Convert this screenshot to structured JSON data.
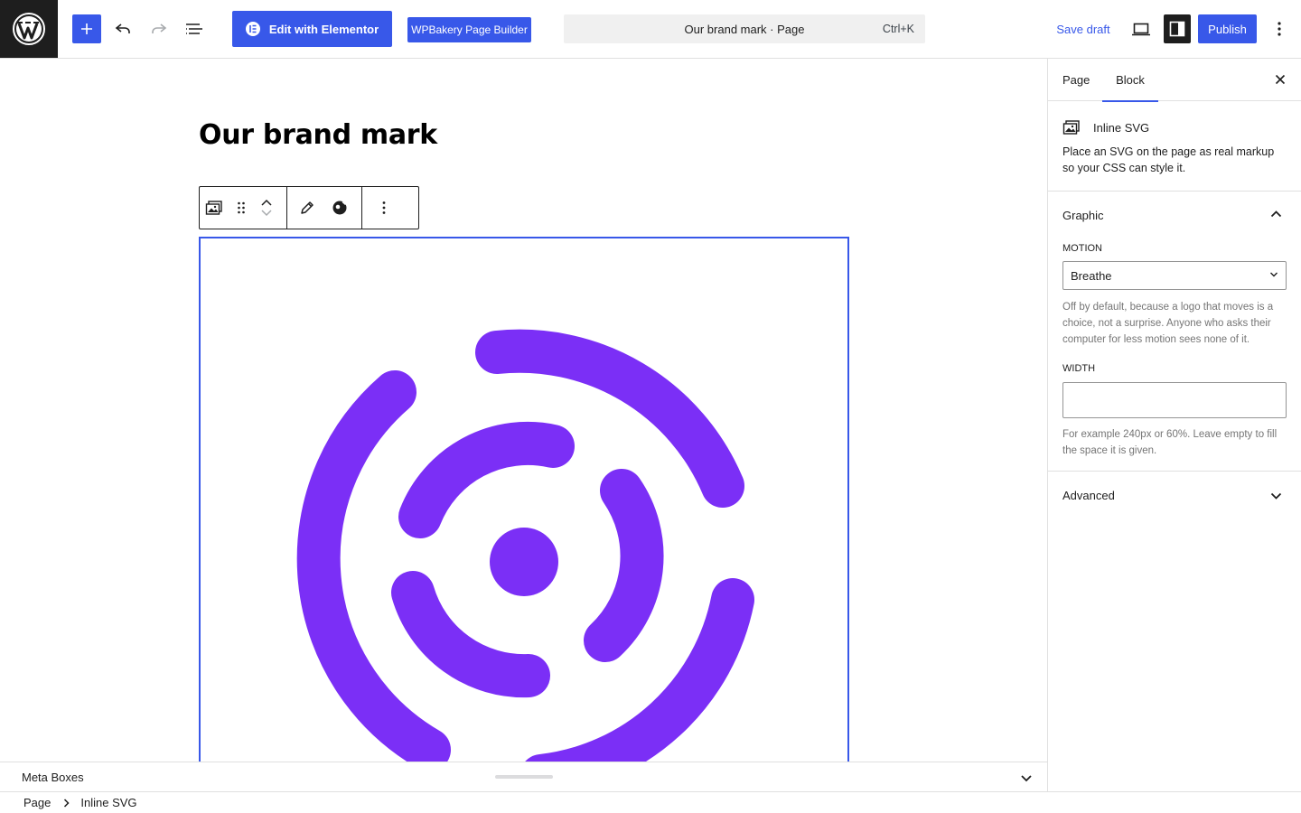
{
  "topbar": {
    "elementor_label": "Edit with Elementor",
    "wpbakery_label": "WPBakery Page Builder",
    "command_title": "Our brand mark · Page",
    "command_shortcut": "Ctrl+K",
    "save_draft_label": "Save draft",
    "publish_label": "Publish"
  },
  "editor": {
    "page_title": "Our brand mark"
  },
  "logo": {
    "color": "#7b2ff6"
  },
  "colors": {
    "accent": "#3858e9",
    "dark": "#1e1e1e"
  },
  "metabox": {
    "label": "Meta Boxes"
  },
  "breadcrumb": {
    "items": [
      "Page",
      "Inline SVG"
    ]
  },
  "sidebar": {
    "tabs": [
      "Page",
      "Block"
    ],
    "active_tab": "Block",
    "block_name": "Inline SVG",
    "block_description": "Place an SVG on the page as real markup so your CSS can style it.",
    "graphic_panel": {
      "title": "Graphic",
      "motion_label": "Motion",
      "motion_value": "Breathe",
      "motion_help": "Off by default, because a logo that moves is a choice, not a surprise. Anyone who asks their computer for less motion sees none of it.",
      "width_label": "Width",
      "width_value": "",
      "width_help": "For example 240px or 60%. Leave empty to fill the space it is given."
    },
    "advanced_panel": {
      "title": "Advanced"
    }
  }
}
